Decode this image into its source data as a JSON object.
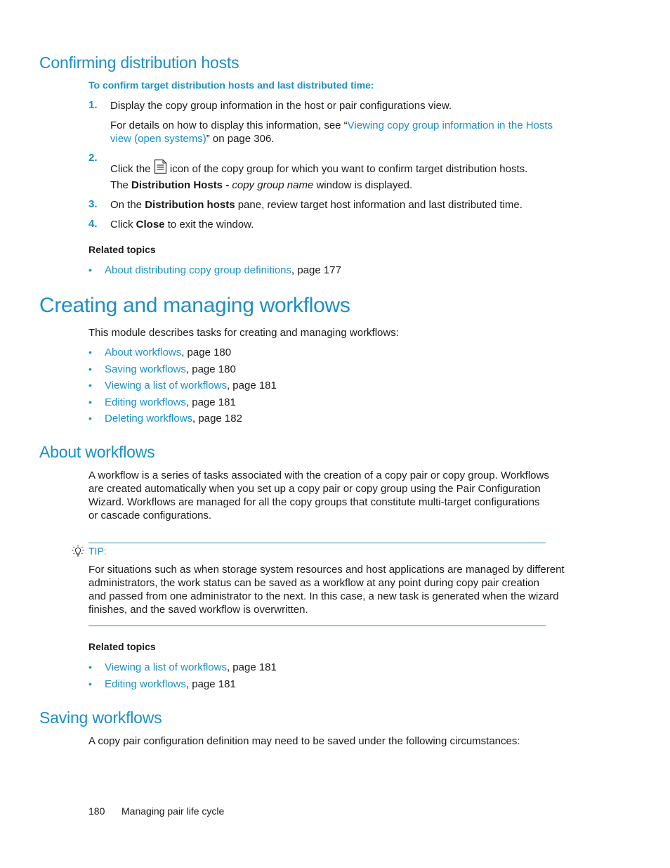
{
  "sections": {
    "confirming": {
      "title": "Confirming distribution hosts",
      "procedure_title": "To confirm target distribution hosts and last distributed time:",
      "steps": [
        {
          "number": "1.",
          "text": "Display the copy group information in the host or pair configurations view.",
          "detail_prefix": "For details on how to display this information, see “",
          "detail_link_line1": "Viewing copy group information in the Hosts",
          "detail_link_line2": "view (open systems)",
          "detail_suffix": "” on page 306."
        },
        {
          "number": "2.",
          "text_before_icon": "Click the",
          "icon": "document-icon",
          "text_after_icon": "icon of the copy group for which you want to confirm target distribution hosts.",
          "result_prefix": "The",
          "result_bold": "Distribution Hosts -",
          "result_italic": "copy group name",
          "result_suffix": "window is displayed."
        },
        {
          "number": "3.",
          "prefix": "On the",
          "bold": "Distribution hosts",
          "suffix": "pane, review target host information and last distributed time."
        },
        {
          "number": "4.",
          "prefix": "Click",
          "bold": "Close",
          "suffix": "to exit the window."
        }
      ],
      "related_title": "Related topics",
      "related": [
        {
          "link": "About distributing copy group definitions",
          "page": ", page 177"
        }
      ]
    },
    "creating": {
      "title": "Creating and managing workflows",
      "intro": "This module describes tasks for creating and managing workflows:",
      "items": [
        {
          "link": "About workflows",
          "page": ", page 180"
        },
        {
          "link": "Saving workflows",
          "page": ", page 180"
        },
        {
          "link": "Viewing a list of workflows",
          "page": ", page 181"
        },
        {
          "link": "Editing workflows",
          "page": ", page 181"
        },
        {
          "link": "Deleting workflows",
          "page": ", page 182"
        }
      ]
    },
    "about": {
      "title": "About workflows",
      "lines": [
        "A workflow is a series of tasks associated with the creation of a copy pair or copy group.  Workflows",
        "are created automatically when you set up a copy pair or copy group using the Pair Configuration",
        "Wizard. Workflows are managed for all the copy groups that constitute multi-target configurations",
        "or cascade configurations."
      ],
      "tip": {
        "icon": "lightbulb-icon",
        "label": "TIP:",
        "lines": [
          "For situations such as when storage system resources and host applications are managed by different",
          "administrators, the work status can be saved as a workflow at any point during copy pair creation",
          "and passed from one administrator to the next. In this case, a new task is generated when the wizard",
          "finishes, and the saved workflow is overwritten."
        ]
      },
      "related_title": "Related topics",
      "related": [
        {
          "link": "Viewing a list of workflows",
          "page": ", page 181"
        },
        {
          "link": "Editing workflows",
          "page": ", page 181"
        }
      ]
    },
    "saving": {
      "title": "Saving workflows",
      "intro": "A copy pair configuration definition may need to be saved under the following circumstances:"
    }
  },
  "footer": {
    "page_number": "180",
    "chapter": "Managing pair life cycle"
  },
  "colors": {
    "accent": "#1a8fc9",
    "text": "#1a1a1a"
  },
  "bullet_char": "•"
}
